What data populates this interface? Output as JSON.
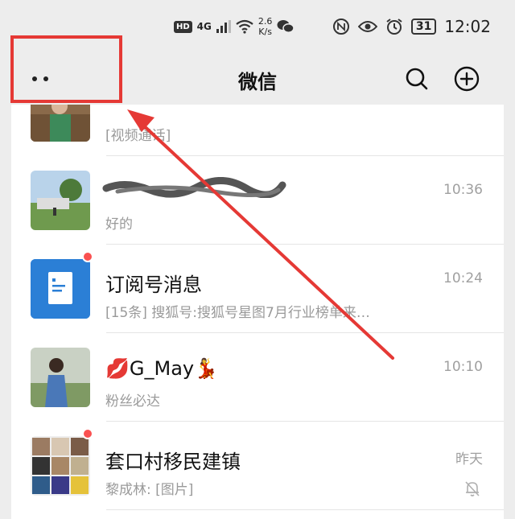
{
  "status_bar": {
    "hd": "HD",
    "signal": "4G",
    "speed_value": "2.6",
    "speed_unit": "K/s",
    "battery": "31",
    "time": "12:02"
  },
  "header": {
    "title": "微信"
  },
  "chats": [
    {
      "name": "",
      "preview": "[视频通话]",
      "time": "",
      "unread": false,
      "muted": false
    },
    {
      "name": "",
      "preview": "好的",
      "time": "10:36",
      "unread": false,
      "muted": false
    },
    {
      "name": "订阅号消息",
      "preview": "[15条] 搜狐号:搜狐号星图7月行业榜单来…",
      "time": "10:24",
      "unread": true,
      "muted": false
    },
    {
      "name": "G_May",
      "preview": "粉丝必达",
      "time": "10:10",
      "unread": false,
      "muted": false
    },
    {
      "name": "套口村移民建镇",
      "preview": "黎成林: [图片]",
      "time": "昨天",
      "unread": true,
      "muted": true
    }
  ],
  "icons": {
    "more": "more-dots-icon",
    "search": "search-icon",
    "add": "add-circle-icon",
    "mute": "bell-off-icon"
  },
  "colors": {
    "annotation_red": "#e53935",
    "unread_red": "#fa5151",
    "subscription_blue": "#2b7fd6"
  }
}
